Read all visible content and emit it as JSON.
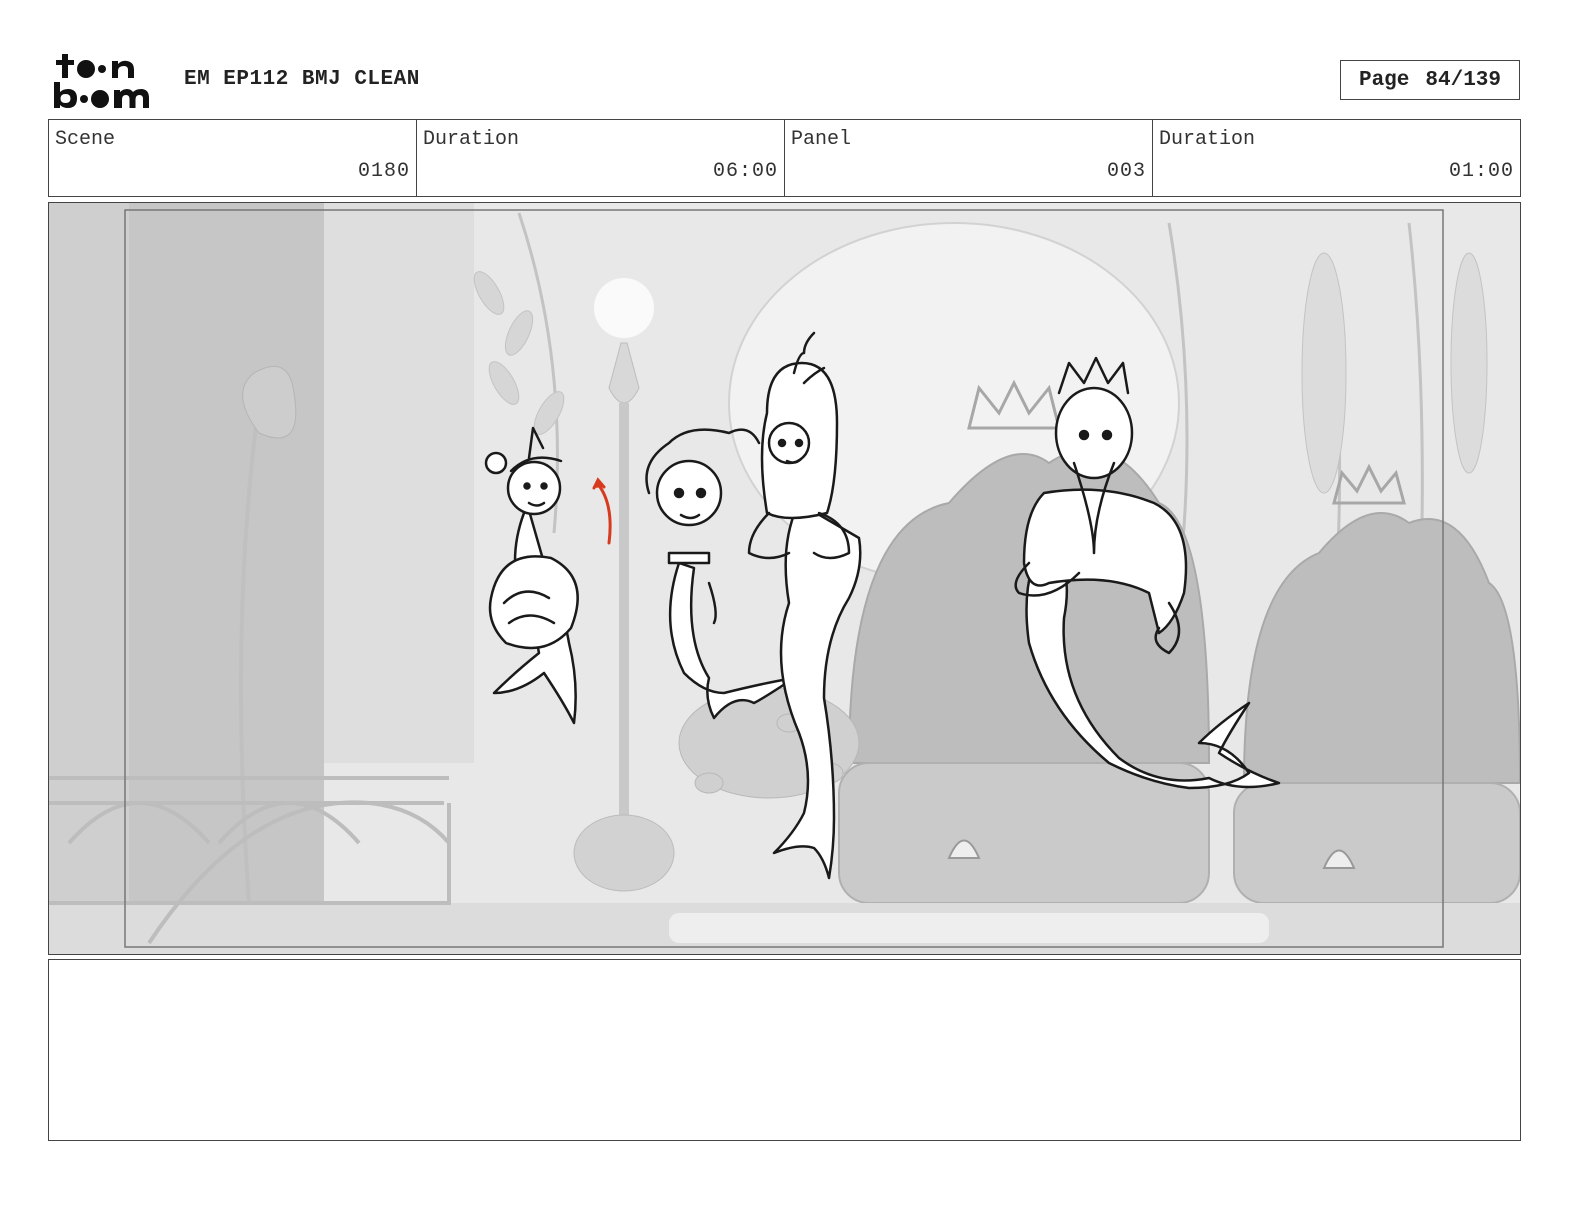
{
  "header": {
    "logo_text": "toon boom",
    "title": "EM EP112 BMJ CLEAN",
    "page_label": "Page",
    "page_number": "84/139"
  },
  "info": {
    "scene_label": "Scene",
    "scene_value": "0180",
    "scene_duration_label": "Duration",
    "scene_duration_value": "06:00",
    "panel_label": "Panel",
    "panel_value": "003",
    "panel_duration_label": "Duration",
    "panel_duration_value": "01:00"
  },
  "panel": {
    "image": "storyboard-sketch-four-merfolk-throne-room",
    "accent_color": "#d83a1e"
  },
  "notes": {
    "text": ""
  }
}
